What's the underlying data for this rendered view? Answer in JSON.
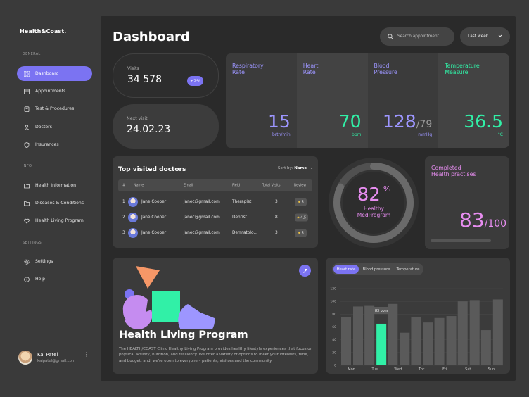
{
  "brand": "Health&Coast.",
  "sidebar": {
    "general_label": "GENERAL",
    "info_label": "INFO",
    "settings_label": "SETTINGS",
    "items": [
      {
        "label": "Dashboard",
        "icon": "grid-icon",
        "active": true
      },
      {
        "label": "Appointments",
        "icon": "calendar-icon"
      },
      {
        "label": "Test & Procedures",
        "icon": "clipboard-icon"
      },
      {
        "label": "Doctors",
        "icon": "person-icon"
      },
      {
        "label": "Insurances",
        "icon": "shield-icon"
      },
      {
        "label": "Health Information",
        "icon": "folder-icon"
      },
      {
        "label": "Diseases & Conditions",
        "icon": "folder-icon"
      },
      {
        "label": "Health Living Program",
        "icon": "heart-icon"
      },
      {
        "label": "Settings",
        "icon": "gear-icon"
      },
      {
        "label": "Help",
        "icon": "help-icon"
      }
    ]
  },
  "user": {
    "name": "Kai Patel",
    "email": "kaipatel@gmail.com"
  },
  "header": {
    "title": "Dashboard",
    "search_placeholder": "Search appointment...",
    "period": "Last week"
  },
  "visits": {
    "label": "Visits",
    "value": "34 578",
    "change": "+2%"
  },
  "next_visit": {
    "label": "Next visit",
    "value": "24.02.23"
  },
  "vitals": [
    {
      "label1": "Respiratory",
      "label2": "Rate",
      "value": "15",
      "unit": "brth/min",
      "color": "#9d96ff"
    },
    {
      "label1": "Heart",
      "label2": "Rate",
      "value": "70",
      "unit": "bpm",
      "color": "#31f0a7"
    },
    {
      "label1": "Blood",
      "label2": "Pressure",
      "value": "128",
      "value2": "/79",
      "unit": "mmHg",
      "color": "#9d96ff"
    },
    {
      "label1": "Temperature",
      "label2": "Measure",
      "value": "36.5",
      "unit": "°C",
      "color": "#31f0a7"
    }
  ],
  "doctors": {
    "title": "Top visited doctors",
    "sort_label": "Sort by:",
    "sort_value": "Name",
    "columns": [
      "#",
      "Name",
      "Email",
      "Field",
      "Total Visits",
      "Review"
    ],
    "rows": [
      {
        "n": "1",
        "name": "Jane Cooper",
        "email": "janec@gmail.com",
        "field": "Therapist",
        "visits": "3",
        "review": "5"
      },
      {
        "n": "2",
        "name": "Jane Cooper",
        "email": "janec@gmail.com",
        "field": "Dentist",
        "visits": "8",
        "review": "4,5"
      },
      {
        "n": "3",
        "name": "Jane Cooper",
        "email": "janec@gmail.com",
        "field": "Dermatolo...",
        "visits": "3",
        "review": "5"
      }
    ]
  },
  "medprogram": {
    "value": "82",
    "unit": "%",
    "label1": "Healthy",
    "label2": "MedProgram",
    "fraction": 0.82
  },
  "completed": {
    "label1": "Completed",
    "label2": "Health practises",
    "value": "83",
    "total": "/100"
  },
  "program": {
    "title": "Health Living Program",
    "description": "The HEALTH/COAST Clinic Healthy Living Program provides healthy lifestyle experiences that focus on physical activity, nutrition, and resiliency. We offer a variety of options to meet your interests, time, and budget, and, we're open to everyone – patients, visitors and the community."
  },
  "chart_tabs": [
    "Heart rate",
    "Blood pressure",
    "Temperature"
  ],
  "chart_data": {
    "type": "bar",
    "categories": [
      "Mon",
      "Tue",
      "Wed",
      "Thr",
      "Fri",
      "Sat",
      "Sun"
    ],
    "series": [
      {
        "values": [
          75,
          93,
          96,
          76,
          74,
          100,
          55
        ]
      },
      {
        "values": [
          92,
          65,
          51,
          67,
          77,
          102,
          103
        ]
      }
    ],
    "highlight": {
      "category": "Tue",
      "value": 76,
      "label": "83 bpm"
    },
    "yticks": [
      "0",
      "20",
      "40",
      "60",
      "80",
      "100",
      "120"
    ],
    "ylim": [
      0,
      120
    ]
  }
}
